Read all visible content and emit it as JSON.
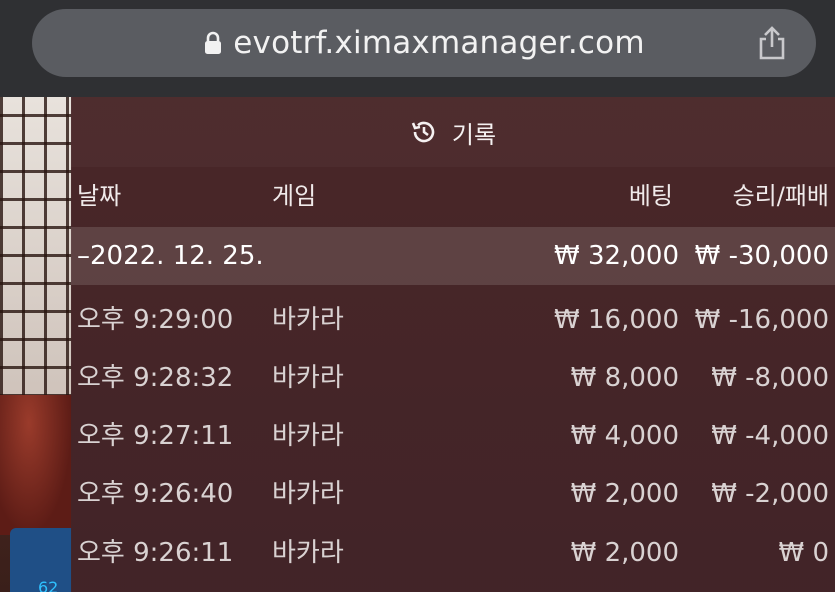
{
  "browser": {
    "url": "evotrf.ximaxmanager.com",
    "lock_icon": "lock-icon",
    "share_icon": "share-icon"
  },
  "game": {
    "gauge_text": "62"
  },
  "history": {
    "title": "기록",
    "title_icon": "history-icon",
    "columns": [
      "날짜",
      "게임",
      "베팅",
      "승리/패배"
    ],
    "date_group": {
      "date": "–2022. 12. 25.",
      "bet_total": "₩ 32,000",
      "win_total": "₩ -30,000"
    },
    "rows": [
      {
        "time": "오후 9:29:00",
        "game": "바카라",
        "bet": "₩ 16,000",
        "result": "₩ -16,000"
      },
      {
        "time": "오후 9:28:32",
        "game": "바카라",
        "bet": "₩ 8,000",
        "result": "₩ -8,000"
      },
      {
        "time": "오후 9:27:11",
        "game": "바카라",
        "bet": "₩ 4,000",
        "result": "₩ -4,000"
      },
      {
        "time": "오후 9:26:40",
        "game": "바카라",
        "bet": "₩ 2,000",
        "result": "₩ -2,000"
      },
      {
        "time": "오후 9:26:11",
        "game": "바카라",
        "bet": "₩ 2,000",
        "result": "₩ 0"
      }
    ]
  },
  "colors": {
    "panel_bg": "#48262a",
    "urlbar_bg": "#5a5c61",
    "text": "#e9e3e3"
  }
}
